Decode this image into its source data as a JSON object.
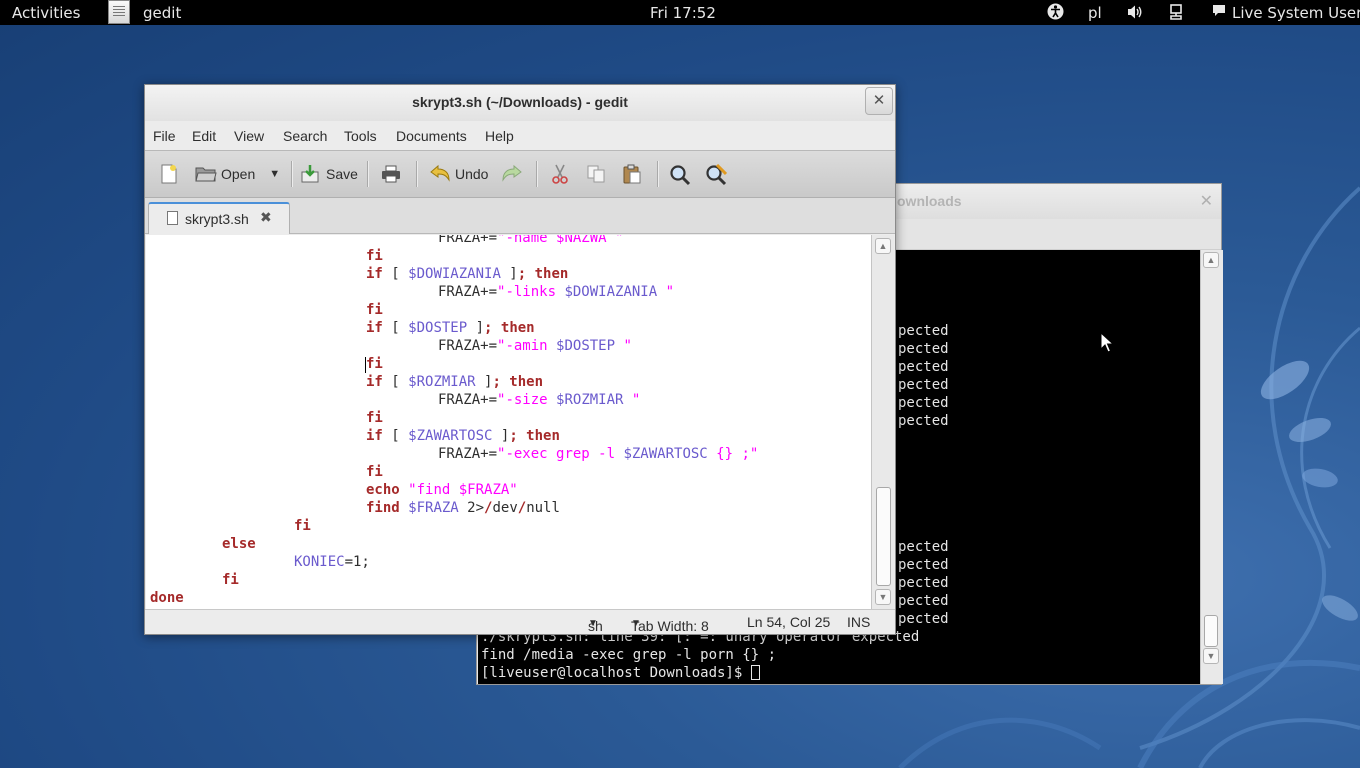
{
  "topbar": {
    "activities": "Activities",
    "app_name": "gedit",
    "clock": "Fri 17:52",
    "keyboard_layout": "pl",
    "user": "Live System User"
  },
  "terminal": {
    "title": "ownloads",
    "lines": [
      "pected",
      "pected",
      "pected",
      "pected",
      "pected",
      "pected",
      "pected",
      "pected",
      "pected",
      "pected",
      "pected"
    ],
    "partial_line": "./skrypt3.sh: line 39: [: =: unary operator expected",
    "find_line": "find /media -exec grep -l porn {} ;",
    "prompt": "[liveuser@localhost Downloads]$ "
  },
  "gedit": {
    "title": "skrypt3.sh (~/Downloads) - gedit",
    "menu": [
      "File",
      "Edit",
      "View",
      "Search",
      "Tools",
      "Documents",
      "Help"
    ],
    "toolbar": {
      "open": "Open",
      "save": "Save",
      "undo": "Undo"
    },
    "tab": {
      "label": "skrypt3.sh",
      "close": "✖"
    },
    "code": [
      {
        "indent": 36,
        "tokens": [
          [
            "",
            "FRAZA+="
          ],
          [
            "str",
            "\"-name $NAZWA \""
          ]
        ]
      },
      {
        "indent": 27,
        "tokens": [
          [
            "kw",
            "fi"
          ]
        ]
      },
      {
        "indent": 27,
        "tokens": [
          [
            "kw",
            "if"
          ],
          [
            "",
            " [ "
          ],
          [
            "var",
            "$DOWIAZANIA"
          ],
          [
            "",
            " ]"
          ],
          [
            "kw",
            "; then"
          ]
        ]
      },
      {
        "indent": 36,
        "tokens": [
          [
            "",
            "FRAZA+="
          ],
          [
            "str",
            "\"-links "
          ],
          [
            "var",
            "$DOWIAZANIA"
          ],
          [
            "str",
            " \""
          ]
        ]
      },
      {
        "indent": 27,
        "tokens": [
          [
            "kw",
            "fi"
          ]
        ]
      },
      {
        "indent": 27,
        "tokens": [
          [
            "kw",
            "if"
          ],
          [
            "",
            " [ "
          ],
          [
            "var",
            "$DOSTEP"
          ],
          [
            "",
            " ]"
          ],
          [
            "kw",
            "; then"
          ]
        ]
      },
      {
        "indent": 36,
        "tokens": [
          [
            "",
            "FRAZA+="
          ],
          [
            "str",
            "\"-amin "
          ],
          [
            "var",
            "$DOSTEP"
          ],
          [
            "str",
            " \""
          ]
        ]
      },
      {
        "indent": 27,
        "tokens": [
          [
            "kw",
            "fi"
          ]
        ]
      },
      {
        "indent": 27,
        "tokens": [
          [
            "kw",
            "if"
          ],
          [
            "",
            " [ "
          ],
          [
            "var",
            "$ROZMIAR"
          ],
          [
            "",
            " ]"
          ],
          [
            "kw",
            "; then"
          ]
        ]
      },
      {
        "indent": 36,
        "tokens": [
          [
            "",
            "FRAZA+="
          ],
          [
            "str",
            "\"-size "
          ],
          [
            "var",
            "$ROZMIAR"
          ],
          [
            "str",
            " \""
          ]
        ]
      },
      {
        "indent": 27,
        "tokens": [
          [
            "kw",
            "fi"
          ]
        ]
      },
      {
        "indent": 27,
        "tokens": [
          [
            "kw",
            "if"
          ],
          [
            "",
            " [ "
          ],
          [
            "var",
            "$ZAWARTOSC"
          ],
          [
            "",
            " ]"
          ],
          [
            "kw",
            "; then"
          ]
        ]
      },
      {
        "indent": 36,
        "tokens": [
          [
            "",
            "FRAZA+="
          ],
          [
            "str",
            "\"-exec grep -l "
          ],
          [
            "var",
            "$ZAWARTOSC"
          ],
          [
            "str",
            " {} ;\""
          ]
        ]
      },
      {
        "indent": 27,
        "tokens": [
          [
            "kw",
            "fi"
          ]
        ]
      },
      {
        "indent": 27,
        "tokens": [
          [
            "kw",
            "echo"
          ],
          [
            "",
            " "
          ],
          [
            "str",
            "\"find $FRAZA\""
          ]
        ]
      },
      {
        "indent": 27,
        "tokens": [
          [
            "kw",
            "find"
          ],
          [
            "",
            " "
          ],
          [
            "var",
            "$FRAZA"
          ],
          [
            "",
            " 2>"
          ],
          [
            "kw",
            "/"
          ],
          [
            "",
            "dev"
          ],
          [
            "kw",
            "/"
          ],
          [
            "",
            "null"
          ]
        ]
      },
      {
        "indent": 18,
        "tokens": [
          [
            "kw",
            "fi"
          ]
        ]
      },
      {
        "indent": 9,
        "tokens": [
          [
            "kw",
            "else"
          ]
        ]
      },
      {
        "indent": 18,
        "tokens": [
          [
            "var",
            "KONIEC"
          ],
          [
            "",
            "=1;"
          ]
        ]
      },
      {
        "indent": 9,
        "tokens": [
          [
            "kw",
            "fi"
          ]
        ]
      },
      {
        "indent": 0,
        "tokens": [
          [
            "kw",
            "done"
          ]
        ]
      }
    ],
    "status": {
      "language": "sh",
      "tab_width": "Tab Width:  8",
      "position": "Ln 54, Col 25",
      "mode": "INS"
    }
  }
}
